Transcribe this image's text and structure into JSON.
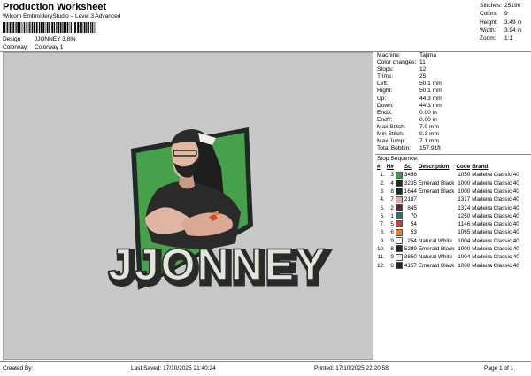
{
  "header": {
    "title": "Production Worksheet",
    "subtitle": "Wilcom EmbroideryStudio – Level 3 Advanced",
    "design_label": "Design:",
    "design_value": "JJONNEY 3,8IN",
    "colorway_label": "Colorway:",
    "colorway_value": "Colorway 1"
  },
  "stats": [
    {
      "label": "Stitches:",
      "value": "25196"
    },
    {
      "label": "Colors:",
      "value": "9"
    },
    {
      "label": "Height:",
      "value": "3.49 in"
    },
    {
      "label": "Width:",
      "value": "3.94 in"
    },
    {
      "label": "Zoom:",
      "value": "1:1"
    }
  ],
  "design_text": "JJONNEY",
  "info": [
    {
      "label": "Machine:",
      "value": "Tajima"
    },
    {
      "label": "Color changes:",
      "value": "11"
    },
    {
      "label": "Stops:",
      "value": "12"
    },
    {
      "label": "Trims:",
      "value": "25"
    },
    {
      "label": "Left:",
      "value": "50.1 mm"
    },
    {
      "label": "Right:",
      "value": "50.1 mm"
    },
    {
      "label": "Up:",
      "value": "44.3 mm"
    },
    {
      "label": "Down:",
      "value": "44.3 mm"
    },
    {
      "label": "EndX:",
      "value": "0.00 in"
    },
    {
      "label": "EndY:",
      "value": "0.00 in"
    },
    {
      "label": "Max Stitch:",
      "value": "7.0 mm"
    },
    {
      "label": "Min Stitch:",
      "value": "0.3 mm"
    },
    {
      "label": "Max Jump:",
      "value": "7.1 mm"
    },
    {
      "label": "Total Bobbin:",
      "value": "157.91ft"
    }
  ],
  "sequence": {
    "title": "Stop Sequence:",
    "headers": [
      "#",
      "N#",
      "St.",
      "Description",
      "Code",
      "Brand"
    ],
    "rows": [
      {
        "n": "1.",
        "needle": "3",
        "color": "#3d9a46",
        "st": "3456",
        "desc": "",
        "code": "1050",
        "brand": "Madeira Classic 40"
      },
      {
        "n": "2.",
        "needle": "4",
        "color": "#1e2a26",
        "st": "3235",
        "desc": "Emerald Black",
        "code": "1000",
        "brand": "Madeira Classic 40"
      },
      {
        "n": "3.",
        "needle": "8",
        "color": "#1e2a26",
        "st": "1644",
        "desc": "Emerald Black",
        "code": "1000",
        "brand": "Madeira Classic 40"
      },
      {
        "n": "4.",
        "needle": "7",
        "color": "#e8a9a6",
        "st": "2187",
        "desc": "",
        "code": "1317",
        "brand": "Madeira Classic 40"
      },
      {
        "n": "5.",
        "needle": "2",
        "color": "#5a2a3a",
        "st": "845",
        "desc": "",
        "code": "1374",
        "brand": "Madeira Classic 40"
      },
      {
        "n": "6.",
        "needle": "1",
        "color": "#1f7a5e",
        "st": "70",
        "desc": "",
        "code": "1250",
        "brand": "Madeira Classic 40"
      },
      {
        "n": "7.",
        "needle": "5",
        "color": "#d63a3a",
        "st": "54",
        "desc": "",
        "code": "1146",
        "brand": "Madeira Classic 40"
      },
      {
        "n": "8.",
        "needle": "6",
        "color": "#ef7d2a",
        "st": "53",
        "desc": "",
        "code": "1065",
        "brand": "Madeira Classic 40"
      },
      {
        "n": "9.",
        "needle": "9",
        "color": "#f2f2ee",
        "st": "254",
        "desc": "Natural White",
        "code": "1004",
        "brand": "Madeira Classic 40"
      },
      {
        "n": "10.",
        "needle": "8",
        "color": "#1e2a26",
        "st": "5289",
        "desc": "Emerald Black",
        "code": "1000",
        "brand": "Madeira Classic 40"
      },
      {
        "n": "11.",
        "needle": "9",
        "color": "#f2f2ee",
        "st": "3850",
        "desc": "Natural White",
        "code": "1004",
        "brand": "Madeira Classic 40"
      },
      {
        "n": "12.",
        "needle": "8",
        "color": "#1e2a26",
        "st": "4157",
        "desc": "Emerald Black",
        "code": "1000",
        "brand": "Madeira Classic 40"
      }
    ]
  },
  "footer": {
    "created": "Created By:",
    "saved": "Last Saved: 17/10/2025 21:40:24",
    "printed": "Printed: 17/10/2025 22:20:58",
    "page": "Page 1 of 1"
  }
}
